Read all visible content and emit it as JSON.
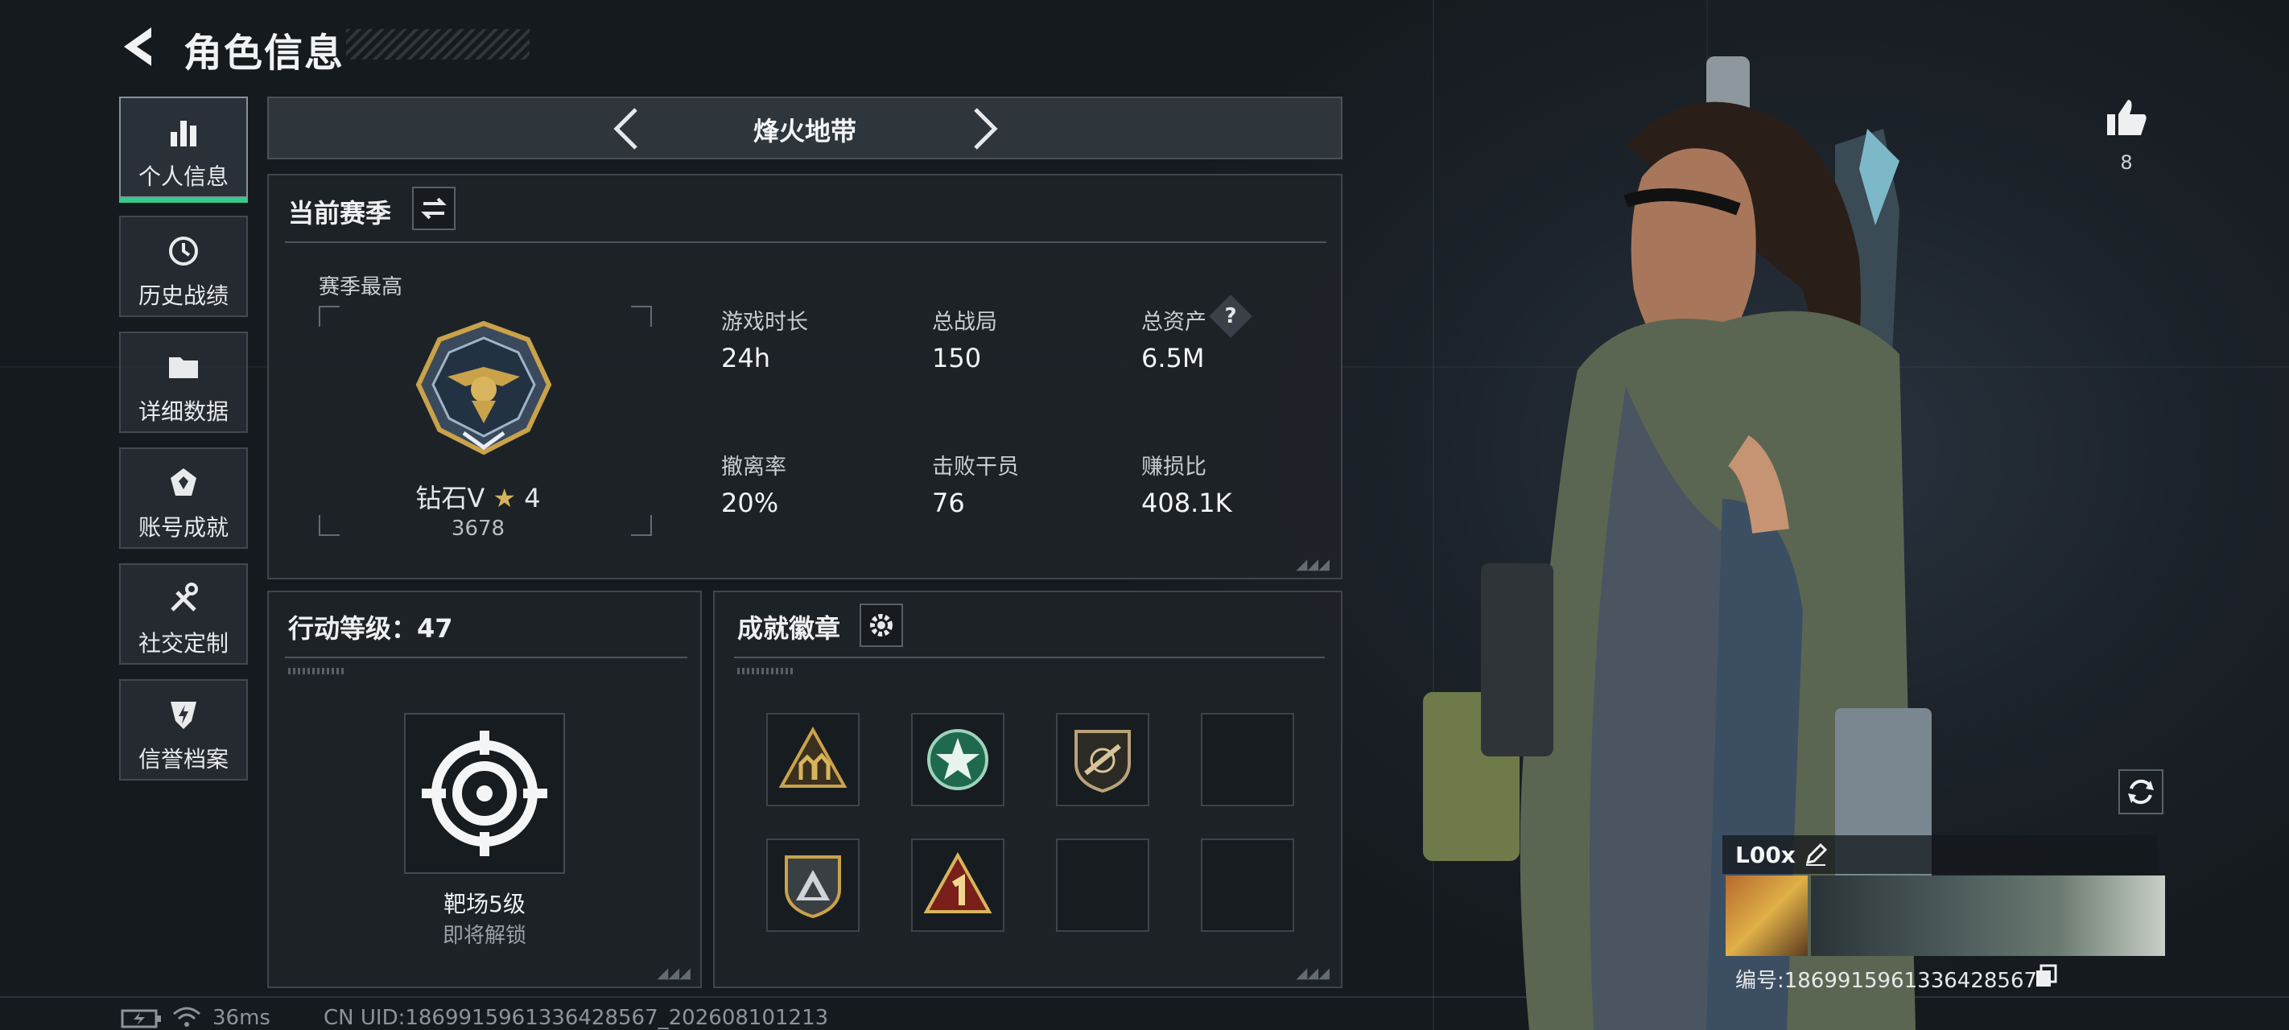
{
  "header": {
    "title": "角色信息"
  },
  "nav": [
    {
      "label": "个人信息",
      "icon": "bar-chart-icon",
      "active": true
    },
    {
      "label": "历史战绩",
      "icon": "history-icon"
    },
    {
      "label": "详细数据",
      "icon": "folder-icon"
    },
    {
      "label": "账号成就",
      "icon": "achievement-icon"
    },
    {
      "label": "社交定制",
      "icon": "tools-icon"
    },
    {
      "label": "信誉档案",
      "icon": "credit-shield-icon"
    }
  ],
  "mode_selector": {
    "name": "烽火地带"
  },
  "season": {
    "title": "当前赛季",
    "best_label": "赛季最高",
    "rank_name": "钻石V",
    "rank_stars": "4",
    "rank_points": "3678",
    "stats": [
      {
        "label": "游戏时长",
        "value": "24h"
      },
      {
        "label": "总战局",
        "value": "150"
      },
      {
        "label": "总资产",
        "value": "6.5M",
        "help": "?"
      },
      {
        "label": "撤离率",
        "value": "20%"
      },
      {
        "label": "击败干员",
        "value": "76"
      },
      {
        "label": "赚损比",
        "value": "408.1K"
      }
    ]
  },
  "action_level": {
    "title": "行动等级：47",
    "item_name": "靶场5级",
    "item_status": "即将解锁"
  },
  "badges": {
    "title": "成就徽章",
    "slots": [
      {
        "icon": "soldiers-triangle-badge-icon",
        "filled": true
      },
      {
        "icon": "star-round-badge-icon",
        "filled": true
      },
      {
        "icon": "rifle-shield-badge-icon",
        "filled": true
      },
      {
        "icon": "empty-slot",
        "filled": false
      },
      {
        "icon": "mountain-shield-badge-icon",
        "filled": true
      },
      {
        "icon": "number-one-triangle-badge-icon",
        "filled": true
      },
      {
        "icon": "empty-slot",
        "filled": false
      },
      {
        "icon": "empty-slot",
        "filled": false
      }
    ]
  },
  "likes": {
    "count": "8"
  },
  "player": {
    "name": "L00x",
    "id_label": "编号:186991596133642856 7",
    "id_text": "编号:1869915961336428567"
  },
  "status_bar": {
    "ping": "36ms",
    "uid": "CN UID:1869915961336428567_202608101213"
  },
  "colors": {
    "accent_green": "#37c88e",
    "gold": "#c9a24a"
  }
}
